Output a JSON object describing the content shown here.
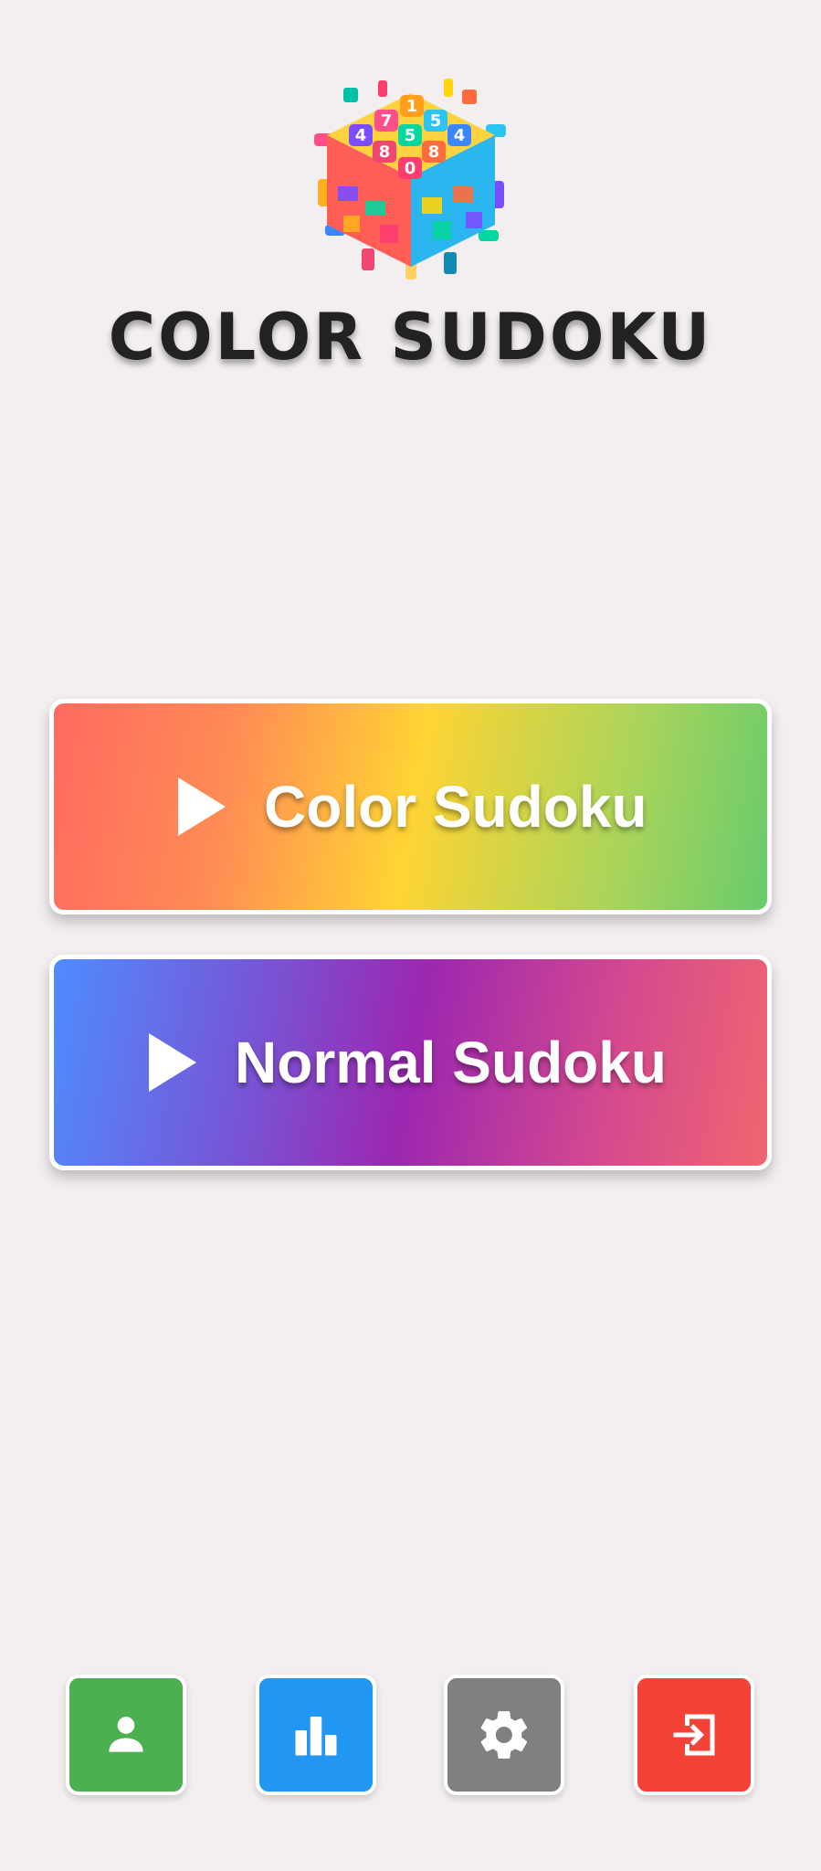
{
  "app": {
    "title": "COLOR SUDOKU"
  },
  "logo": {
    "icon": "sudoku-cube-logo",
    "numbers": [
      "1",
      "7",
      "5",
      "4",
      "5",
      "4",
      "8",
      "8",
      "0"
    ]
  },
  "modes": {
    "color": {
      "label": "Color Sudoku",
      "icon": "play-icon"
    },
    "normal": {
      "label": "Normal Sudoku",
      "icon": "play-icon"
    }
  },
  "bottom_bar": {
    "profile": {
      "icon": "person-icon",
      "color": "#4caf50"
    },
    "stats": {
      "icon": "bar-chart-icon",
      "color": "#2196f3"
    },
    "settings": {
      "icon": "gear-icon",
      "color": "#808080"
    },
    "exit": {
      "icon": "exit-icon",
      "color": "#f44336"
    }
  },
  "colors": {
    "background": "#f3eff0",
    "title_text": "#222222"
  }
}
